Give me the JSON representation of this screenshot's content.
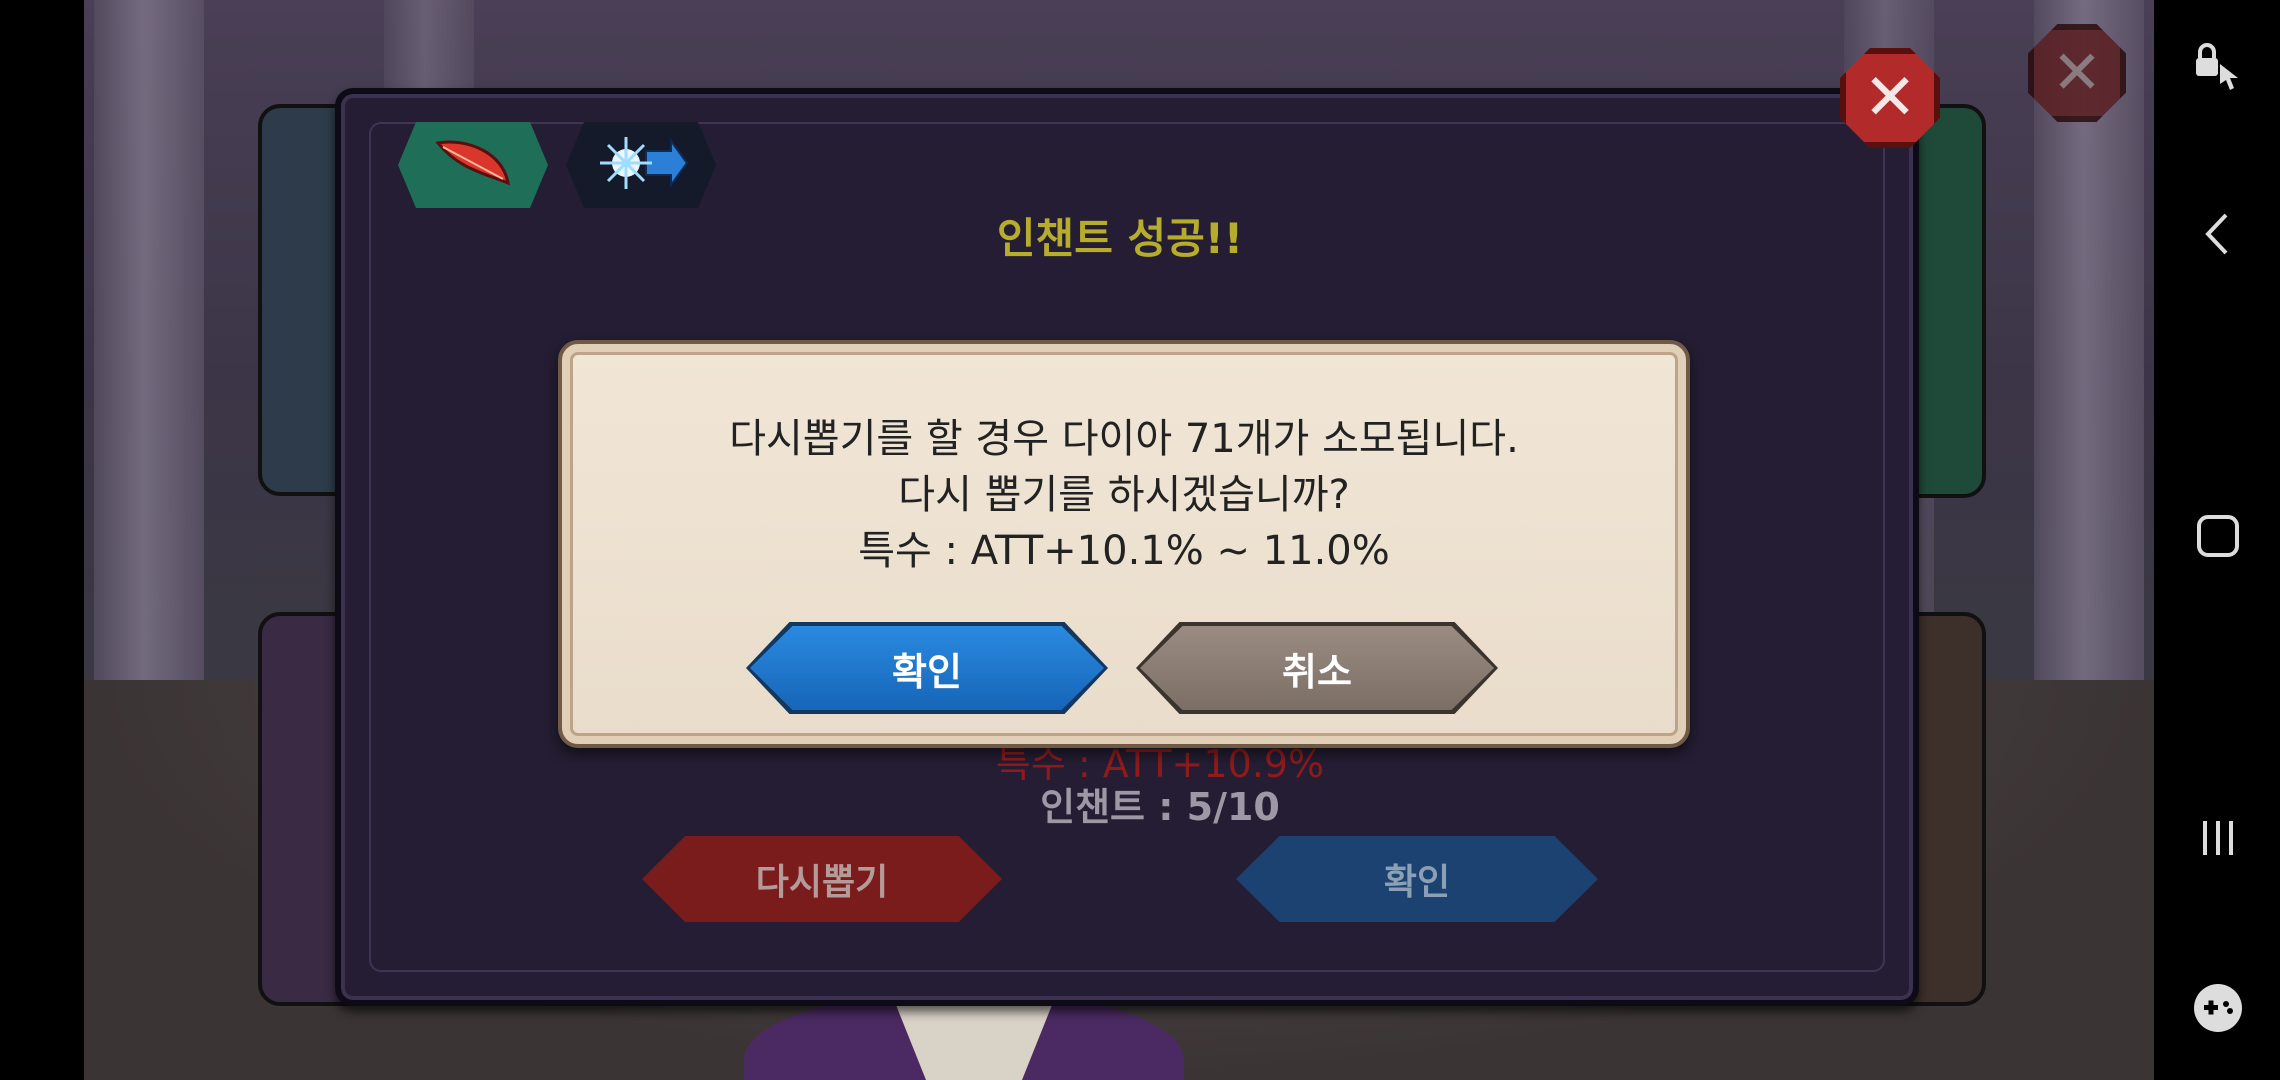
{
  "header": {
    "title": "인챈트 성공!!"
  },
  "dialog": {
    "line1": "다시뽑기를 할 경우 다이아 71개가 소모됩니다.",
    "line2": "다시 뽑기를 하시겠습니까?",
    "line3": "특수 : ATT+10.1% ~ 11.0%",
    "confirm_label": "확인",
    "cancel_label": "취소"
  },
  "result": {
    "special_stat": "특수 : ATT+10.9%",
    "enchant_level": "인챈트 : 5/10"
  },
  "actions": {
    "reroll_label": "다시뽑기",
    "confirm_label": "확인"
  },
  "icons": {
    "tab1": "feather-icon",
    "tab2": "burst-arrow-icon",
    "close": "close-icon",
    "nav": [
      "lock-touch-icon",
      "back-icon",
      "home-icon",
      "recents-icon",
      "game-tools-icon"
    ]
  },
  "colors": {
    "title": "#b7ad2c",
    "confirm_blue": "#1d6fc4",
    "cancel_gray": "#8a7d73",
    "reroll_red": "#a12020"
  }
}
